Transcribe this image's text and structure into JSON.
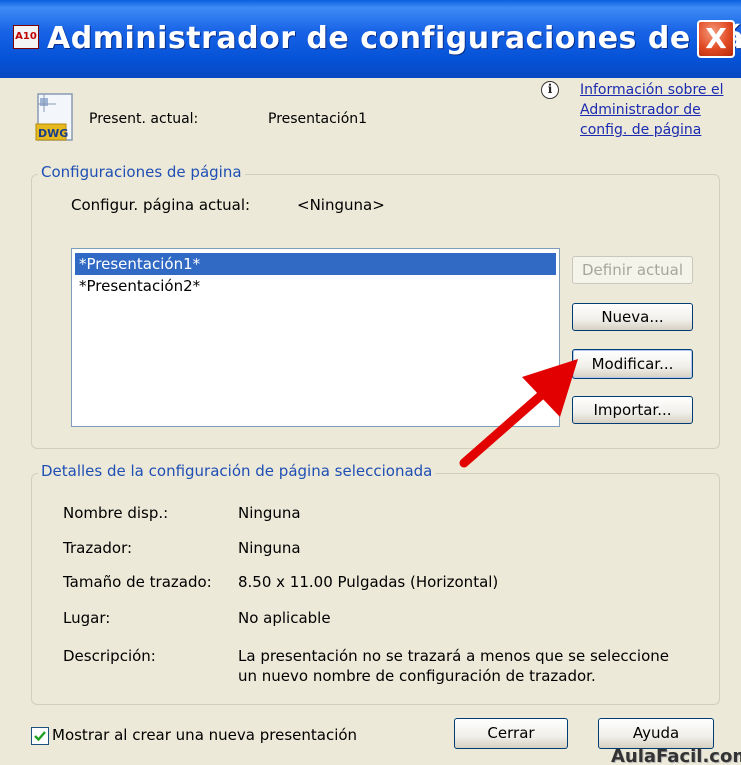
{
  "window": {
    "title": "Administrador de configuraciones de página",
    "app_icon_text": "A10",
    "close_label": "X"
  },
  "current": {
    "icon_text": "DWG",
    "label": "Present. actual:",
    "value": "Presentación1"
  },
  "info_link": {
    "lines": [
      "Información sobre el",
      "Administrador de",
      "config. de página"
    ]
  },
  "page_setups": {
    "group_title": "Configuraciones de página",
    "current_label": "Configur. página actual:",
    "current_value": "<Ninguna>",
    "items": [
      "*Presentación1*",
      "*Presentación2*"
    ],
    "selected_index": 0,
    "buttons": {
      "set_current": "Definir actual",
      "new": "Nueva...",
      "modify": "Modificar...",
      "import": "Importar..."
    }
  },
  "details": {
    "group_title": "Detalles de la configuración de página seleccionada",
    "rows": [
      {
        "label": "Nombre disp.:",
        "value": "Ninguna"
      },
      {
        "label": "Trazador:",
        "value": "Ninguna"
      },
      {
        "label": "Tamaño de trazado:",
        "value": "8.50 x 11.00 Pulgadas (Horizontal)"
      },
      {
        "label": "Lugar:",
        "value": "No aplicable"
      },
      {
        "label": "Descripción:",
        "value_lines": [
          "La presentación no se trazará a menos que se seleccione",
          "un nuevo nombre de configuración de trazador."
        ]
      }
    ]
  },
  "footer": {
    "checkbox_label": "Mostrar al crear una nueva presentación",
    "checkbox_checked": true,
    "close_button": "Cerrar",
    "help_button": "Ayuda"
  },
  "watermark": "AulaFacil.com",
  "colors": {
    "titlebar": "#0653d8",
    "dialog_bg": "#ece9d8",
    "selection": "#316ac5",
    "group_title": "#1f4fb5",
    "link": "#1c2bb0",
    "annotation_arrow": "#e30000"
  }
}
